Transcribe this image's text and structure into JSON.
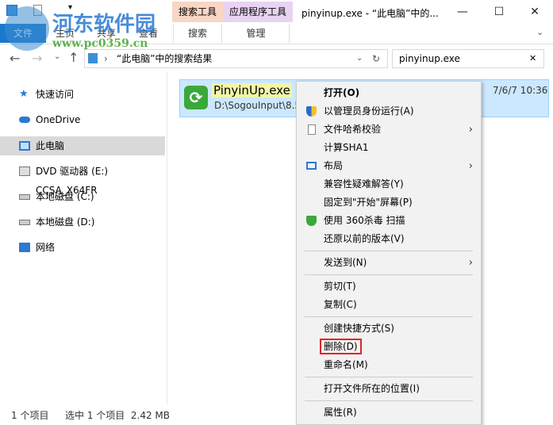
{
  "watermark": {
    "name": "河东软件园",
    "url": "www.pc0359.cn"
  },
  "titlebar": {
    "context_tabs": [
      "搜索工具",
      "应用程序工具"
    ],
    "title": "pinyinup.exe - “此电脑”中的...",
    "minimize": "—",
    "maximize": "☐",
    "close": "✕"
  },
  "ribbon": {
    "tabs": [
      "文件",
      "主页",
      "共享",
      "查看",
      "搜索",
      "管理"
    ]
  },
  "address": {
    "path": "“此电脑”中的搜索结果",
    "search_value": "pinyinup.exe",
    "clear": "✕",
    "refresh": "↻"
  },
  "nav": {
    "items": [
      "快速访问",
      "OneDrive",
      "此电脑",
      "DVD 驱动器 (E:) CCSA_X64FR",
      "本地磁盘 (C:)",
      "本地磁盘 (D:)",
      "网络"
    ]
  },
  "file": {
    "name": "PinyinUp.exe",
    "path": "D:\\SogouInput\\8.5",
    "date": "7/6/7 10:36"
  },
  "menu": {
    "items": [
      "打开(O)",
      "以管理员身份运行(A)",
      "文件哈希校验",
      "计算SHA1",
      "布局",
      "兼容性疑难解答(Y)",
      "固定到\"开始\"屏幕(P)",
      "使用 360杀毒 扫描",
      "还原以前的版本(V)",
      "发送到(N)",
      "剪切(T)",
      "复制(C)",
      "创建快捷方式(S)",
      "删除(D)",
      "重命名(M)",
      "打开文件所在的位置(I)",
      "属性(R)"
    ]
  },
  "status": {
    "count": "1 个项目",
    "selected": "选中 1 个项目  2.42 MB"
  },
  "colors": {
    "search_tab": "#f9d6c4",
    "app_tab": "#e9d3f2",
    "selection": "#cce8ff",
    "highlight_box": "#e0242a"
  }
}
